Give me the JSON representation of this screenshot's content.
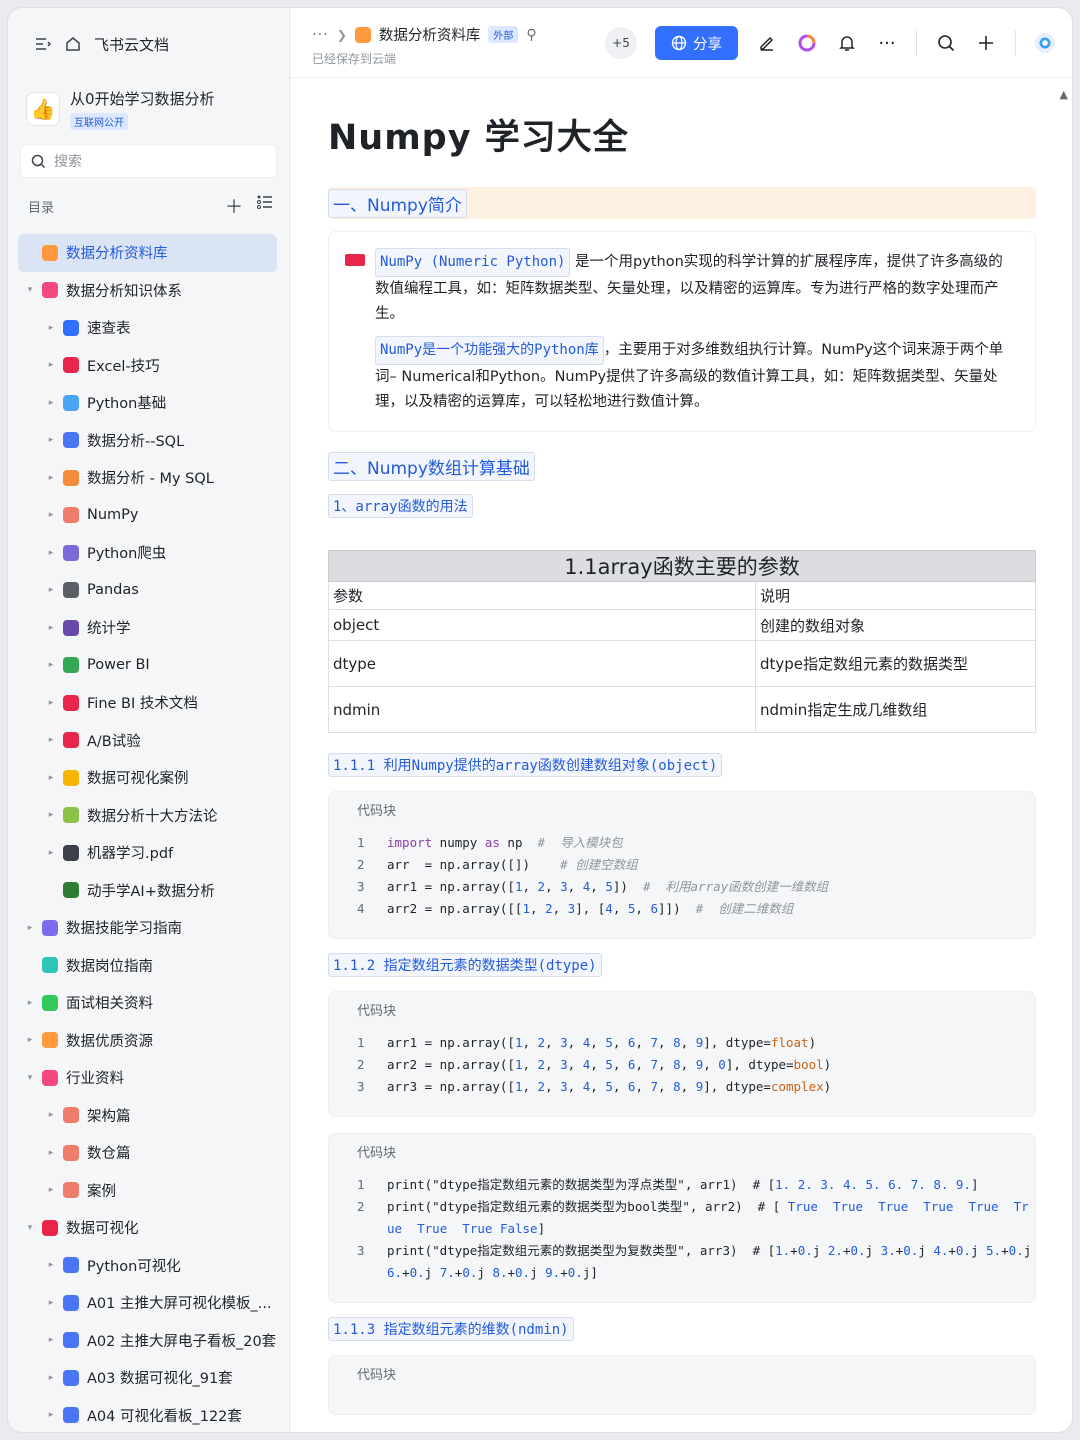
{
  "sidebar": {
    "home_label": "飞书云文档",
    "wiki_title": "从0开始学习数据分析",
    "wiki_badge": "互联网公开",
    "search_placeholder": "搜索",
    "toc_label": "目录",
    "items": [
      {
        "label": "数据分析资料库",
        "level": 0,
        "arrow": "",
        "icon_color": "#ff9b3d",
        "active": true
      },
      {
        "label": "数据分析知识体系",
        "level": 0,
        "arrow": "▾",
        "icon_color": "#f5487f"
      },
      {
        "label": "速查表",
        "level": 1,
        "arrow": "▸",
        "icon_color": "#3370ff"
      },
      {
        "label": "Excel-技巧",
        "level": 1,
        "arrow": "▸",
        "icon_color": "#e8254a"
      },
      {
        "label": "Python基础",
        "level": 1,
        "arrow": "▸",
        "icon_color": "#4aa6f5"
      },
      {
        "label": "数据分析--SQL",
        "level": 1,
        "arrow": "▸",
        "icon_color": "#4a76f5"
      },
      {
        "label": "数据分析 - My SQL",
        "level": 1,
        "arrow": "▸",
        "icon_color": "#f58a3d"
      },
      {
        "label": "NumPy",
        "level": 1,
        "arrow": "▸",
        "icon_color": "#f07c6a"
      },
      {
        "label": "Python爬虫",
        "level": 1,
        "arrow": "▸",
        "icon_color": "#7a6ad8"
      },
      {
        "label": "Pandas",
        "level": 1,
        "arrow": "▸",
        "icon_color": "#5b5f66"
      },
      {
        "label": "统计学",
        "level": 1,
        "arrow": "▸",
        "icon_color": "#6a4aa8"
      },
      {
        "label": "Power BI",
        "level": 1,
        "arrow": "▸",
        "icon_color": "#34a853"
      },
      {
        "label": "Fine BI 技术文档",
        "level": 1,
        "arrow": "▸",
        "icon_color": "#e8254a"
      },
      {
        "label": "A/B试验",
        "level": 1,
        "arrow": "▸",
        "icon_color": "#e8254a"
      },
      {
        "label": "数据可视化案例",
        "level": 1,
        "arrow": "▸",
        "icon_color": "#f5b400"
      },
      {
        "label": "数据分析十大方法论",
        "level": 1,
        "arrow": "▸",
        "icon_color": "#8bc34a"
      },
      {
        "label": "机器学习.pdf",
        "level": 1,
        "arrow": "▸",
        "icon_color": "#3d424a"
      },
      {
        "label": "动手学AI+数据分析",
        "level": 1,
        "arrow": "",
        "icon_color": "#2e7d32"
      },
      {
        "label": "数据技能学习指南",
        "level": 0,
        "arrow": "▸",
        "icon_color": "#7b6cf0"
      },
      {
        "label": "数据岗位指南",
        "level": 0,
        "arrow": "",
        "icon_color": "#2ec4b6"
      },
      {
        "label": "面试相关资料",
        "level": 0,
        "arrow": "▸",
        "icon_color": "#34c759"
      },
      {
        "label": "数据优质资源",
        "level": 0,
        "arrow": "▸",
        "icon_color": "#ff9b3d"
      },
      {
        "label": "行业资料",
        "level": 0,
        "arrow": "▾",
        "icon_color": "#f5487f"
      },
      {
        "label": "架构篇",
        "level": 1,
        "arrow": "▸",
        "icon_color": "#f07c6a"
      },
      {
        "label": "数仓篇",
        "level": 1,
        "arrow": "▸",
        "icon_color": "#f07c6a"
      },
      {
        "label": "案例",
        "level": 1,
        "arrow": "▸",
        "icon_color": "#f07c6a"
      },
      {
        "label": "数据可视化",
        "level": 0,
        "arrow": "▾",
        "icon_color": "#e8254a"
      },
      {
        "label": "Python可视化",
        "level": 1,
        "arrow": "▸",
        "icon_color": "#4a76f5"
      },
      {
        "label": "A01 主推大屏可视化模板_...",
        "level": 1,
        "arrow": "▸",
        "icon_color": "#4a76f5"
      },
      {
        "label": "A02 主推大屏电子看板_20套",
        "level": 1,
        "arrow": "▸",
        "icon_color": "#4a76f5"
      },
      {
        "label": "A03 数据可视化_91套",
        "level": 1,
        "arrow": "▸",
        "icon_color": "#4a76f5"
      },
      {
        "label": "A04 可视化看板_122套",
        "level": 1,
        "arrow": "▸",
        "icon_color": "#4a76f5"
      }
    ]
  },
  "header": {
    "breadcrumb_dots": "···",
    "doc_name": "数据分析资料库",
    "external_badge": "外部",
    "saved_status": "已经保存到云端",
    "collaborators_more": "+5",
    "share_label": "分享"
  },
  "doc": {
    "title": "Numpy 学习大全",
    "section1": "一、Numpy简介",
    "intro_p1_tag": "NumPy (Numeric Python)",
    "intro_p1_text": "是一个用python实现的科学计算的扩展程序库，提供了许多高级的数值编程工具，如：矩阵数据类型、矢量处理，以及精密的运算库。专为进行严格的数字处理而产生。",
    "intro_p2_tag": "NumPy是一个功能强大的Python库",
    "intro_p2_text": "，主要用于对多维数组执行计算。NumPy这个词来源于两个单词– Numerical和Python。NumPy提供了许多高级的数值计算工具，如：矩阵数据类型、矢量处理，以及精密的运算库，可以轻松地进行数值计算。",
    "section2": "二、Numpy数组计算基础",
    "sub1": "1、array函数的用法",
    "table": {
      "caption": "1.1array函数主要的参数",
      "headers": [
        "参数",
        "说明"
      ],
      "rows": [
        [
          "object",
          "创建的数组对象"
        ],
        [
          "dtype",
          "dtype指定数组元素的数据类型"
        ],
        [
          "ndmin",
          "ndmin指定生成几维数组"
        ]
      ]
    },
    "sub111": "1.1.1 利用Numpy提供的array函数创建数组对象(object)",
    "code_label": "代码块",
    "sub112": "1.1.2 指定数组元素的数据类型(dtype)",
    "sub113": "1.1.3 指定数组元素的维数(ndmin)",
    "code1": [
      {
        "n": "1",
        "t": "import numpy as np  #  导入模块包"
      },
      {
        "n": "2",
        "t": "arr  = np.array([])    # 创建空数组"
      },
      {
        "n": "3",
        "t": "arr1 = np.array([1, 2, 3, 4, 5])  #  利用array函数创建一维数组"
      },
      {
        "n": "4",
        "t": "arr2 = np.array([[1, 2, 3], [4, 5, 6]])  #  创建二维数组"
      }
    ],
    "code2": [
      {
        "n": "1",
        "t": "arr1 = np.array([1, 2, 3, 4, 5, 6, 7, 8, 9], dtype=float)"
      },
      {
        "n": "2",
        "t": "arr2 = np.array([1, 2, 3, 4, 5, 6, 7, 8, 9, 0], dtype=bool)"
      },
      {
        "n": "3",
        "t": "arr3 = np.array([1, 2, 3, 4, 5, 6, 7, 8, 9], dtype=complex)"
      }
    ],
    "code3": [
      {
        "n": "1",
        "t": "print(\"dtype指定数组元素的数据类型为浮点类型\", arr1)  # [1. 2. 3. 4. 5. 6. 7. 8. 9.]"
      },
      {
        "n": "2",
        "t": "print(\"dtype指定数组元素的数据类型为bool类型\", arr2)  # [ True  True  True  True  True  True  True  True False]"
      },
      {
        "n": "3",
        "t": "print(\"dtype指定数组元素的数据类型为复数类型\", arr3)  # [1.+0.j 2.+0.j 3.+0.j 4.+0.j 5.+0.j 6.+0.j 7.+0.j 8.+0.j 9.+0.j]"
      }
    ]
  }
}
